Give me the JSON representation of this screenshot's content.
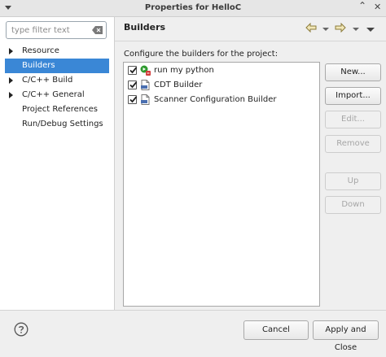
{
  "window": {
    "title": "Properties for HelloC"
  },
  "filter": {
    "placeholder": "type filter text"
  },
  "tree": {
    "items": [
      {
        "label": "Resource",
        "expandable": true
      },
      {
        "label": "Builders",
        "expandable": false,
        "selected": true
      },
      {
        "label": "C/C++ Build",
        "expandable": true
      },
      {
        "label": "C/C++ General",
        "expandable": true
      },
      {
        "label": "Project References",
        "expandable": false
      },
      {
        "label": "Run/Debug Settings",
        "expandable": false
      }
    ]
  },
  "page": {
    "title": "Builders",
    "description": "Configure the builders for the project:"
  },
  "builders": [
    {
      "label": "run my python",
      "checked": true,
      "icon": "external-tool-icon"
    },
    {
      "label": "CDT Builder",
      "checked": true,
      "icon": "builder-icon"
    },
    {
      "label": "Scanner Configuration Builder",
      "checked": true,
      "icon": "builder-icon"
    }
  ],
  "buttons": {
    "new": "New...",
    "import": "Import...",
    "edit": "Edit...",
    "remove": "Remove",
    "up": "Up",
    "down": "Down",
    "cancel": "Cancel",
    "apply_close": "Apply and Close"
  },
  "colors": {
    "selection": "#3a87d6",
    "accent_green": "#2f9a2f",
    "accent_red": "#d23b3b"
  }
}
